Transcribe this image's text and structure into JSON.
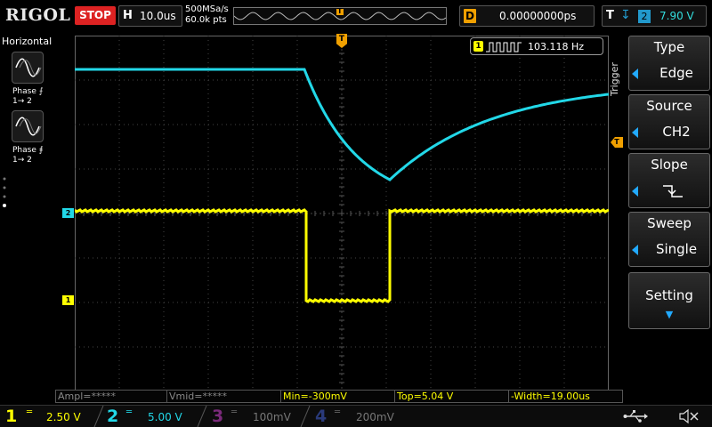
{
  "topbar": {
    "brand": "RIGOL",
    "run_state": "STOP",
    "timebase_letter": "H",
    "timebase": "10.0us",
    "sample_rate": "500MSa/s",
    "mem_depth": "60.0k pts",
    "trigger_pos_marker": "T",
    "delay_letter": "D",
    "delay": "0.00000000ps",
    "trigger_letter": "T",
    "trigger_channel": "2",
    "trigger_level": "7.90 V"
  },
  "left_panel": {
    "title": "Horizontal",
    "phase1_label_line1": "Phase",
    "phase1_label_line2": "1→ 2",
    "phase2_label_line1": "Phase",
    "phase2_label_line2": "1→ 2"
  },
  "screen": {
    "freq_channel": "1",
    "freq_value": "103.118 Hz",
    "ch2_marker": "2",
    "ch1_marker": "1",
    "trig_marker": "T"
  },
  "menu": {
    "header": "Trigger",
    "items": [
      {
        "title": "Type",
        "value": "Edge"
      },
      {
        "title": "Source",
        "value": "CH2"
      },
      {
        "title": "Slope",
        "value": "↵"
      },
      {
        "title": "Sweep",
        "value": "Single"
      },
      {
        "title": "Setting",
        "value": "▼"
      }
    ]
  },
  "measurements": {
    "ampl": "Ampl=*****",
    "vmid": "Vmid=*****",
    "min": "Min=-300mV",
    "top": "Top=5.04 V",
    "width": "-Width=19.00us"
  },
  "channels": [
    {
      "num": "1",
      "scale": "2.50 V",
      "color": "#ffff00"
    },
    {
      "num": "2",
      "scale": "5.00 V",
      "color": "#00e5ff"
    },
    {
      "num": "3",
      "scale": "100mV",
      "color": "#ff00ff"
    },
    {
      "num": "4",
      "scale": "200mV",
      "color": "#3a6dff"
    }
  ],
  "colors": {
    "ch1": "#ffff00",
    "ch2": "#22d8e8",
    "accent": "#f0a000",
    "stop": "#dd2222"
  },
  "icons": [
    "usb-icon",
    "speaker-mute-icon"
  ]
}
